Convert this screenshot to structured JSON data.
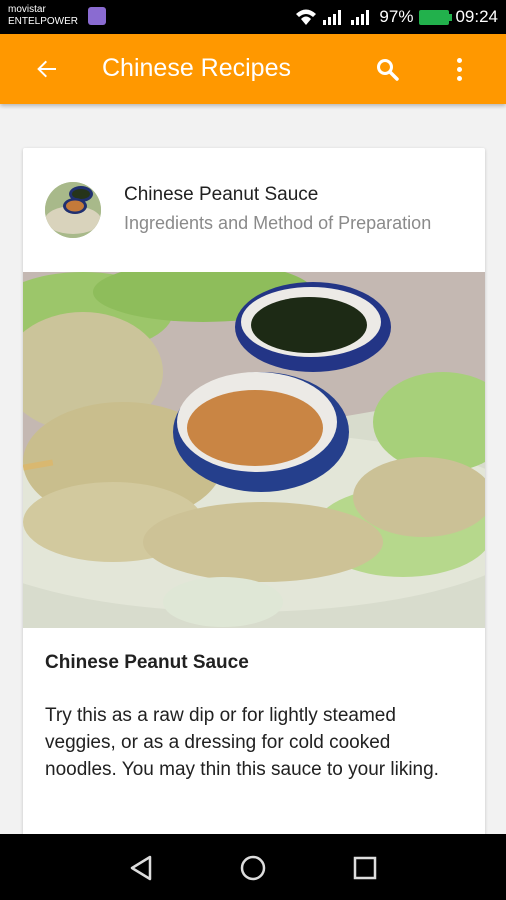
{
  "status_bar": {
    "carrier_line1": "movistar",
    "carrier_line2": "ENTELPOWER",
    "battery_percent": "97%",
    "time": "09:24"
  },
  "app_bar": {
    "title": "Chinese Recipes",
    "back_icon": "arrow-left-icon",
    "search_icon": "search-icon",
    "more_icon": "more-vertical-icon",
    "color": "#ff9800"
  },
  "recipe": {
    "title": "Chinese Peanut Sauce",
    "subtitle": "Ingredients and Method of Preparation",
    "body_title": "Chinese Peanut Sauce",
    "description": "Try this as a raw dip or for lightly steamed veggies, or as a dressing for cold cooked noodles. You may thin this sauce to your liking."
  },
  "nav_bar": {
    "back": "nav-back-icon",
    "home": "nav-home-icon",
    "recents": "nav-recents-icon"
  }
}
